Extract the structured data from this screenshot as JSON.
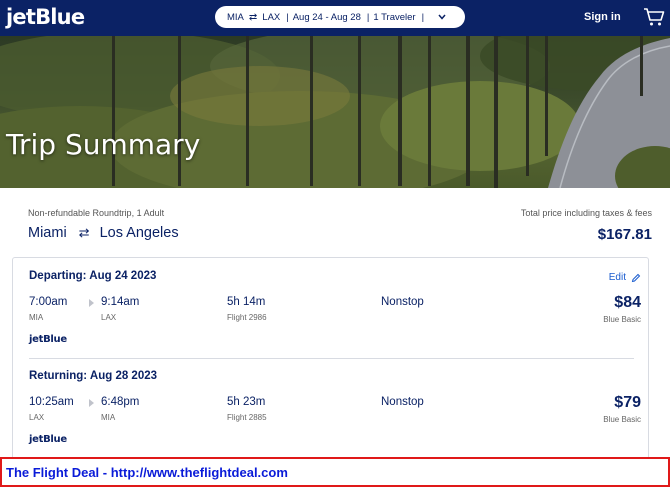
{
  "header": {
    "logo": "jetBlue",
    "search": {
      "origin": "MIA",
      "destination": "LAX",
      "dates": "Aug 24 - Aug 28",
      "travelers": "1 Traveler"
    },
    "sign_in_label": "Sign in",
    "cart_icon": "cart-icon"
  },
  "hero": {
    "title": "Trip Summary"
  },
  "summary": {
    "trip_meta": "Non-refundable Roundtrip, 1 Adult",
    "total_label": "Total price including taxes & fees",
    "origin_city": "Miami",
    "destination_city": "Los Angeles",
    "total_price": "$167.81",
    "edit_label": "Edit"
  },
  "legs": [
    {
      "title": "Departing: Aug 24 2023",
      "depart_time": "7:00am",
      "depart_code": "MIA",
      "arrive_time": "9:14am",
      "arrive_code": "LAX",
      "duration": "5h 14m",
      "flight": "Flight 2986",
      "stops": "Nonstop",
      "price": "$84",
      "fare": "Blue Basic",
      "airline": "jetBlue"
    },
    {
      "title": "Returning: Aug 28 2023",
      "depart_time": "10:25am",
      "depart_code": "LAX",
      "arrive_time": "6:48pm",
      "arrive_code": "MIA",
      "duration": "5h 23m",
      "flight": "Flight 2885",
      "stops": "Nonstop",
      "price": "$79",
      "fare": "Blue Basic",
      "airline": "jetBlue"
    }
  ],
  "banner": {
    "text": "The Flight Deal - http://www.theflightdeal.com"
  },
  "colors": {
    "brand_navy": "#0b2265",
    "link_blue": "#1a5ccf",
    "banner_border": "#e01919",
    "banner_text": "#0a1bd8"
  }
}
